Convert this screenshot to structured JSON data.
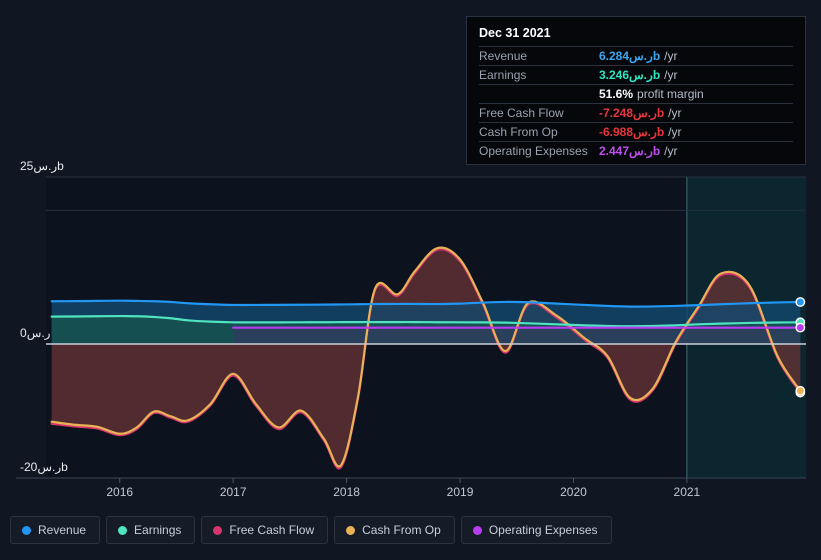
{
  "chart_data": {
    "type": "area",
    "title": "",
    "xlabel": "",
    "ylabel": "",
    "currency_symbol": "ر.س",
    "unit_suffix": "b",
    "period_suffix": "/yr",
    "grid": true,
    "legend_position": "bottom",
    "xlim": [
      2015.35,
      2022.05
    ],
    "ylim": [
      -20,
      25
    ],
    "y_ticks": [
      {
        "value": 25,
        "label": "ر.س25b"
      },
      {
        "value": 0,
        "label": "ر.س0"
      },
      {
        "value": -20,
        "label": "-20ر.سb"
      }
    ],
    "y_gridlines": [
      25,
      20,
      -20
    ],
    "x_ticks": [
      {
        "value": 2016,
        "label": "2016"
      },
      {
        "value": 2017,
        "label": "2017"
      },
      {
        "value": 2018,
        "label": "2018"
      },
      {
        "value": 2019,
        "label": "2019"
      },
      {
        "value": 2020,
        "label": "2020"
      },
      {
        "value": 2021,
        "label": "2021"
      }
    ],
    "highlight_band": {
      "from": 2021.0,
      "to": 2022.05
    },
    "x": [
      2015.4,
      2015.6,
      2015.8,
      2016.0,
      2016.15,
      2016.3,
      2016.45,
      2016.6,
      2016.8,
      2017.0,
      2017.2,
      2017.4,
      2017.6,
      2017.8,
      2017.95,
      2018.1,
      2018.25,
      2018.45,
      2018.6,
      2018.8,
      2019.0,
      2019.2,
      2019.4,
      2019.6,
      2019.85,
      2020.1,
      2020.3,
      2020.5,
      2020.7,
      2020.9,
      2021.1,
      2021.3,
      2021.55,
      2021.8,
      2022.0
    ],
    "series": [
      {
        "name": "Revenue",
        "color": "#2196f3",
        "fill": "#13486e",
        "values": [
          6.4,
          6.42,
          6.45,
          6.48,
          6.45,
          6.4,
          6.3,
          6.1,
          5.95,
          5.85,
          5.85,
          5.86,
          5.88,
          5.9,
          5.92,
          5.95,
          5.98,
          6.0,
          6.0,
          5.98,
          6.05,
          6.2,
          6.3,
          6.25,
          6.05,
          5.85,
          5.7,
          5.6,
          5.62,
          5.7,
          5.82,
          5.95,
          6.1,
          6.22,
          6.284
        ]
      },
      {
        "name": "Earnings",
        "color": "#4fe3c0",
        "fill": "#17554f",
        "values": [
          4.1,
          4.12,
          4.15,
          4.18,
          4.15,
          4.05,
          3.85,
          3.55,
          3.35,
          3.25,
          3.24,
          3.24,
          3.25,
          3.26,
          3.27,
          3.28,
          3.28,
          3.28,
          3.28,
          3.26,
          3.25,
          3.24,
          3.2,
          3.1,
          2.95,
          2.8,
          2.7,
          2.66,
          2.7,
          2.8,
          2.95,
          3.05,
          3.15,
          3.22,
          3.246
        ]
      },
      {
        "name": "Free Cash Flow",
        "color": "#d6356e",
        "fill": "#5a2230",
        "values": [
          -11.9,
          -12.3,
          -12.6,
          -13.6,
          -12.7,
          -10.3,
          -11.0,
          -11.6,
          -9.15,
          -4.7,
          -9.2,
          -12.7,
          -10.2,
          -14.4,
          -18.4,
          -8.2,
          8.0,
          7.2,
          10.6,
          14.1,
          12.4,
          6.0,
          -1.3,
          5.9,
          4.0,
          0.6,
          -2.05,
          -8.3,
          -6.9,
          0.0,
          5.3,
          10.3,
          8.55,
          -2.1,
          -7.248
        ]
      },
      {
        "name": "Cash From Op",
        "color": "#e8b356",
        "fill": "#6b3b38",
        "values": [
          -11.6,
          -12.05,
          -12.35,
          -13.4,
          -12.45,
          -10.1,
          -10.8,
          -11.4,
          -8.95,
          -4.45,
          -8.95,
          -12.45,
          -9.95,
          -14.15,
          -18.1,
          -7.95,
          8.25,
          7.45,
          10.85,
          14.35,
          12.65,
          6.25,
          -1.05,
          6.15,
          4.25,
          0.85,
          -1.8,
          -8.05,
          -6.65,
          0.25,
          5.55,
          10.55,
          8.8,
          -1.85,
          -6.988
        ]
      },
      {
        "name": "Operating Expenses",
        "color": "#b83df0",
        "fill": "#3b3363",
        "values": [
          null,
          null,
          null,
          null,
          null,
          null,
          null,
          null,
          null,
          2.44,
          2.44,
          2.44,
          2.44,
          2.44,
          2.44,
          2.44,
          2.44,
          2.44,
          2.44,
          2.44,
          2.44,
          2.44,
          2.44,
          2.44,
          2.44,
          2.44,
          2.44,
          2.44,
          2.44,
          2.44,
          2.44,
          2.44,
          2.44,
          2.45,
          2.447
        ]
      }
    ]
  },
  "tooltip": {
    "title": "Dec 31 2021",
    "rows": [
      {
        "label": "Revenue",
        "value": "6.284ر.سb",
        "suffix": "/yr",
        "color": "#3ba7f0"
      },
      {
        "label": "Earnings",
        "value": "3.246ر.سb",
        "suffix": "/yr",
        "color": "#2ee6c0"
      },
      {
        "label": "",
        "value": "51.6%",
        "suffix": "profit margin",
        "color": "#ffffff"
      },
      {
        "label": "Free Cash Flow",
        "value": "-7.248ر.سb",
        "suffix": "/yr",
        "color": "#e8363b"
      },
      {
        "label": "Cash From Op",
        "value": "-6.988ر.سb",
        "suffix": "/yr",
        "color": "#e8363b"
      },
      {
        "label": "Operating Expenses",
        "value": "2.447ر.سb",
        "suffix": "/yr",
        "color": "#c04ff0"
      }
    ]
  },
  "legend": {
    "items": [
      {
        "label": "Revenue",
        "color": "#2196f3"
      },
      {
        "label": "Earnings",
        "color": "#4fe3c0"
      },
      {
        "label": "Free Cash Flow",
        "color": "#d6356e"
      },
      {
        "label": "Cash From Op",
        "color": "#e8b356"
      },
      {
        "label": "Operating Expenses",
        "color": "#b83df0"
      }
    ]
  }
}
